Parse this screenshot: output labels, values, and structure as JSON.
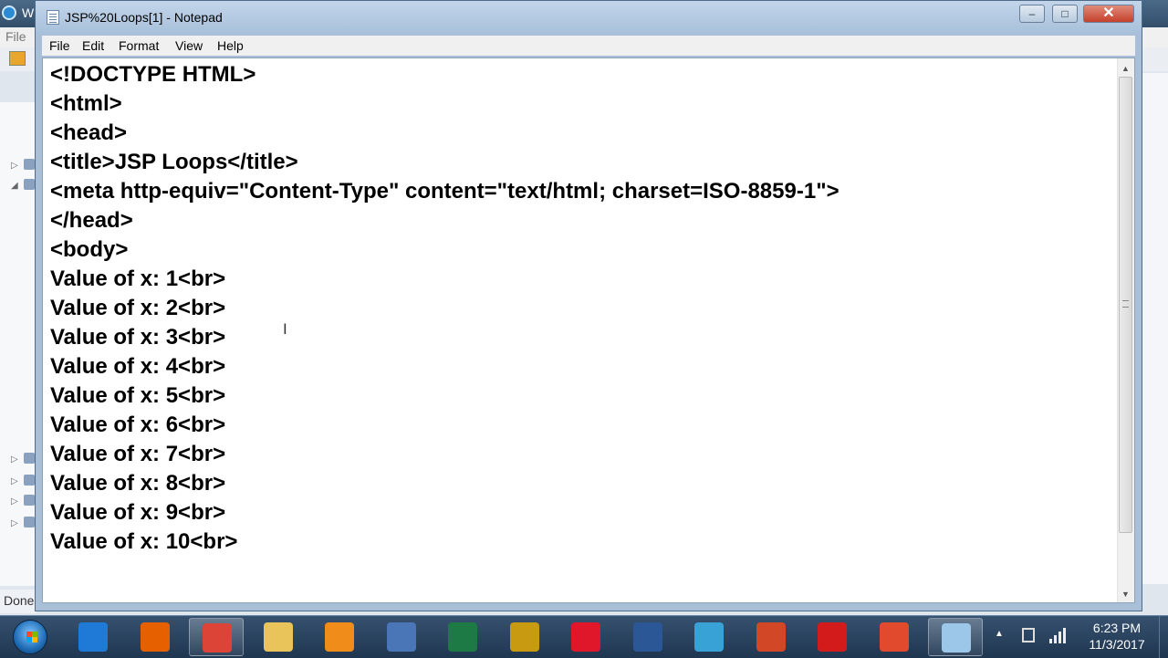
{
  "background_app": {
    "title": "W",
    "menu_file": "File",
    "status_text": "Done"
  },
  "notepad": {
    "title": "JSP%20Loops[1] - Notepad",
    "menu": [
      "File",
      "Edit",
      "Format",
      "View",
      "Help"
    ],
    "window_buttons": {
      "minimize": "–",
      "maximize": "□",
      "close": "✕"
    },
    "content_lines": [
      "<!DOCTYPE HTML>",
      "<html>",
      "<head>",
      "<title>JSP Loops</title>",
      "<meta http-equiv=\"Content-Type\" content=\"text/html; charset=ISO-8859-1\">",
      "</head>",
      "<body>",
      "Value of x: 1<br>",
      "Value of x: 2<br>",
      "Value of x: 3<br>",
      "Value of x: 4<br>",
      "Value of x: 5<br>",
      "Value of x: 6<br>",
      "Value of x: 7<br>",
      "Value of x: 8<br>",
      "Value of x: 9<br>",
      "Value of x: 10<br>"
    ]
  },
  "taskbar": {
    "apps": [
      {
        "name": "internet-explorer",
        "color": "#1e7ad6",
        "active": false
      },
      {
        "name": "firefox",
        "color": "#e66000",
        "active": false
      },
      {
        "name": "chrome",
        "color": "#db4437",
        "active": true
      },
      {
        "name": "file-explorer",
        "color": "#e8c45a",
        "active": false
      },
      {
        "name": "media-player",
        "color": "#f08c1a",
        "active": false
      },
      {
        "name": "calendar-app",
        "color": "#4a76b8",
        "active": false
      },
      {
        "name": "excel",
        "color": "#1d7a45",
        "active": false
      },
      {
        "name": "audio-app",
        "color": "#c89a12",
        "active": false
      },
      {
        "name": "opera",
        "color": "#e0162b",
        "active": false
      },
      {
        "name": "word",
        "color": "#2b5797",
        "active": false
      },
      {
        "name": "network-app",
        "color": "#38a1d6",
        "active": false
      },
      {
        "name": "powerpoint",
        "color": "#d24726",
        "active": false
      },
      {
        "name": "acrobat",
        "color": "#d41b1b",
        "active": false
      },
      {
        "name": "camtasia",
        "color": "#e24a2e",
        "active": false
      },
      {
        "name": "notepad",
        "color": "#9cc7e8",
        "active": true
      }
    ],
    "clock_time": "6:23 PM",
    "clock_date": "11/3/2017"
  }
}
